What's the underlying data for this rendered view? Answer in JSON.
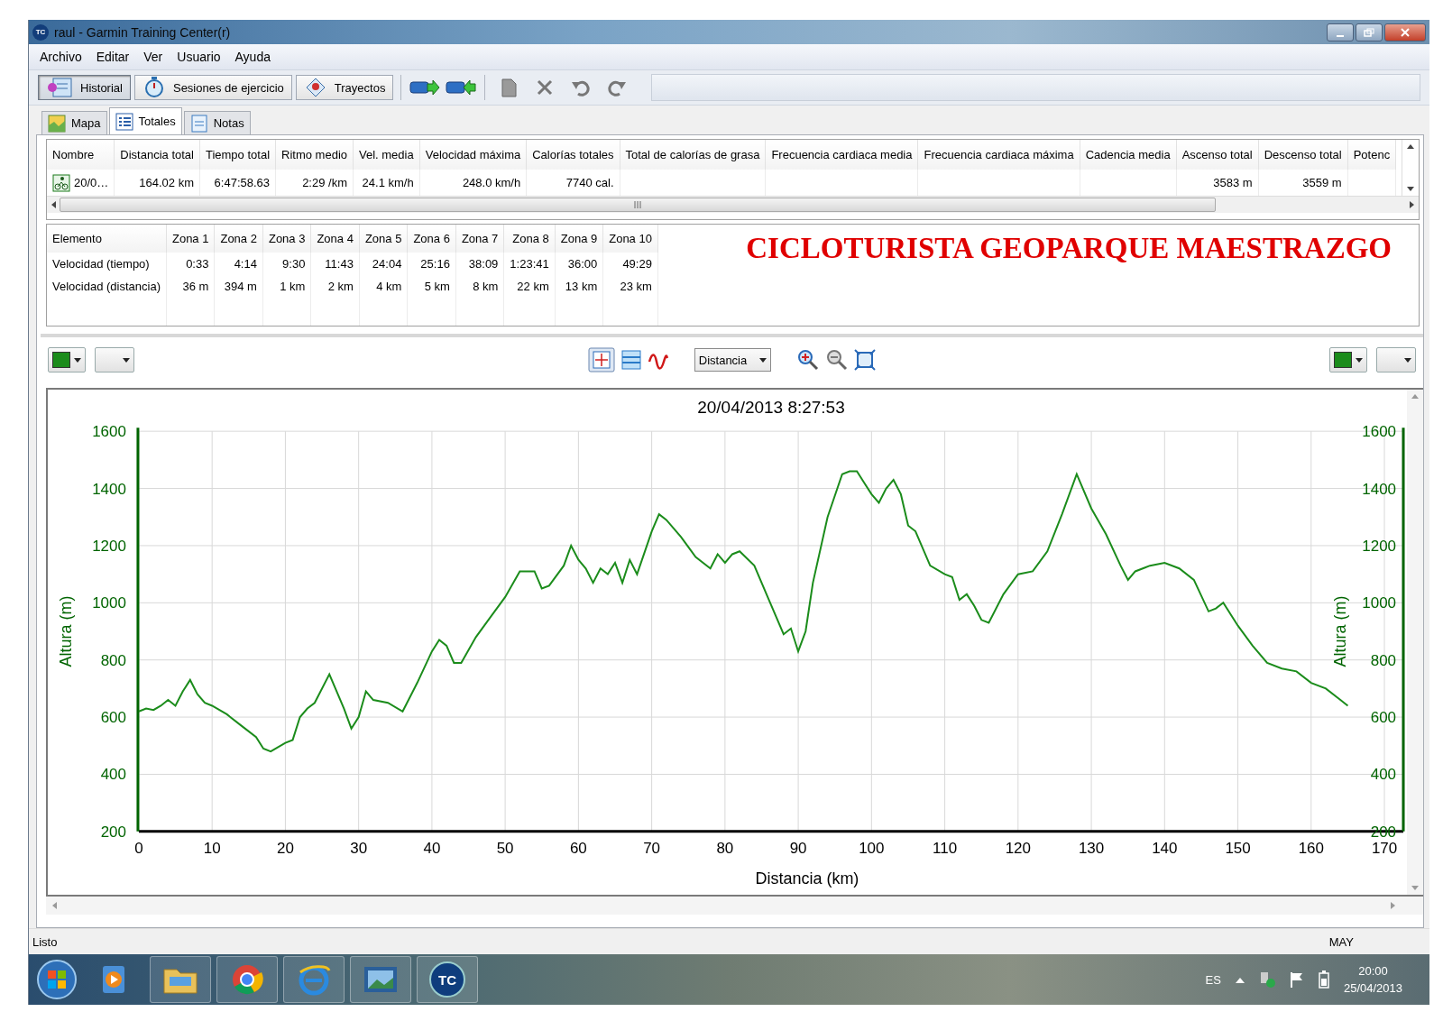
{
  "window": {
    "app_icon_text": "TC",
    "title": "raul - Garmin Training Center(r)"
  },
  "menu": [
    "Archivo",
    "Editar",
    "Ver",
    "Usuario",
    "Ayuda"
  ],
  "toolbar": {
    "views": [
      {
        "label": "Historial",
        "selected": true
      },
      {
        "label": "Sesiones de ejercicio",
        "selected": false
      },
      {
        "label": "Trayectos",
        "selected": false
      }
    ]
  },
  "subtabs": [
    {
      "label": "Mapa",
      "selected": false
    },
    {
      "label": "Totales",
      "selected": true
    },
    {
      "label": "Notas",
      "selected": false
    }
  ],
  "totals_table": {
    "columns": [
      "Nombre",
      "Distancia total",
      "Tiempo total",
      "Ritmo medio",
      "Vel. media",
      "Velocidad máxima",
      "Calorías totales",
      "Total de calorías de grasa",
      "Frecuencia cardiaca media",
      "Frecuencia cardiaca máxima",
      "Cadencia media",
      "Ascenso total",
      "Descenso total",
      "Potenc"
    ],
    "rows": [
      {
        "cells": [
          "20/0…",
          "164.02 km",
          "6:47:58.63",
          "2:29 /km",
          "24.1 km/h",
          "248.0 km/h",
          "7740 cal.",
          null,
          null,
          null,
          null,
          "3583 m",
          "3559 m",
          null
        ]
      }
    ]
  },
  "zones_table": {
    "columns": [
      "Elemento",
      "Zona 1",
      "Zona 2",
      "Zona 3",
      "Zona 4",
      "Zona 5",
      "Zona 6",
      "Zona 7",
      "Zona 8",
      "Zona 9",
      "Zona 10"
    ],
    "rows": [
      [
        "Velocidad (tiempo)",
        "0:33",
        "4:14",
        "9:30",
        "11:43",
        "24:04",
        "25:16",
        "38:09",
        "1:23:41",
        "36:00",
        "49:29"
      ],
      [
        "Velocidad (distancia)",
        "36 m",
        "394 m",
        "1 km",
        "2 km",
        "4 km",
        "5 km",
        "8 km",
        "22 km",
        "13 km",
        "23 km"
      ]
    ]
  },
  "banner": "CICLOTURISTA GEOPARQUE MAESTRAZGO",
  "chart_toolbar": {
    "axis_select": "Distancia"
  },
  "chart": {
    "chart_data": {
      "type": "line",
      "title": "20/04/2013 8:27:53",
      "xlabel": "Distancia (km)",
      "ylabel": "Altura (m)",
      "grid": true,
      "xlim": [
        0,
        170
      ],
      "ylim": [
        200,
        1600
      ],
      "xticks": [
        0,
        10,
        20,
        30,
        40,
        50,
        60,
        70,
        80,
        90,
        100,
        110,
        120,
        130,
        140,
        150,
        160,
        170
      ],
      "yticks": [
        {
          "value": 1600,
          "label": "1600"
        },
        {
          "value": 1400,
          "label": "1400"
        },
        {
          "value": 1200,
          "label": "1200"
        },
        {
          "value": 1000,
          "label": "1000"
        },
        {
          "value": 800,
          "label": "800"
        },
        {
          "value": 600,
          "label": "600"
        },
        {
          "value": 400,
          "label": "400"
        },
        {
          "value": 200,
          "label": "200"
        }
      ],
      "x": [
        0,
        1,
        2,
        3,
        4,
        5,
        6,
        7,
        8,
        9,
        10,
        12,
        14,
        16,
        17,
        18,
        20,
        21,
        22,
        23,
        24,
        26,
        28,
        29,
        30,
        31,
        32,
        34,
        36,
        38,
        40,
        41,
        42,
        43,
        44,
        46,
        48,
        50,
        52,
        54,
        55,
        56,
        58,
        59,
        60,
        61,
        62,
        63,
        64,
        65,
        66,
        67,
        68,
        70,
        71,
        72,
        74,
        76,
        78,
        79,
        80,
        81,
        82,
        84,
        86,
        88,
        89,
        90,
        91,
        92,
        94,
        96,
        97,
        98,
        99,
        100,
        101,
        102,
        103,
        104,
        105,
        106,
        108,
        110,
        111,
        112,
        113,
        114,
        115,
        116,
        118,
        120,
        122,
        124,
        126,
        128,
        130,
        132,
        134,
        135,
        136,
        138,
        140,
        142,
        144,
        146,
        147,
        148,
        150,
        152,
        154,
        156,
        158,
        160,
        162,
        164,
        165
      ],
      "series": [
        {
          "color": "#1b8c1b",
          "values": [
            620,
            630,
            625,
            640,
            660,
            640,
            690,
            730,
            680,
            650,
            640,
            610,
            570,
            530,
            490,
            480,
            510,
            520,
            600,
            630,
            650,
            750,
            630,
            560,
            600,
            690,
            660,
            650,
            620,
            720,
            830,
            870,
            850,
            790,
            790,
            880,
            950,
            1020,
            1110,
            1110,
            1050,
            1060,
            1130,
            1200,
            1150,
            1120,
            1070,
            1120,
            1100,
            1140,
            1070,
            1150,
            1100,
            1250,
            1310,
            1290,
            1230,
            1160,
            1120,
            1170,
            1140,
            1170,
            1180,
            1130,
            1010,
            890,
            910,
            830,
            900,
            1070,
            1300,
            1450,
            1460,
            1460,
            1420,
            1380,
            1350,
            1400,
            1430,
            1380,
            1270,
            1250,
            1130,
            1100,
            1090,
            1010,
            1030,
            990,
            940,
            930,
            1030,
            1100,
            1110,
            1180,
            1310,
            1450,
            1330,
            1240,
            1130,
            1080,
            1110,
            1130,
            1140,
            1120,
            1080,
            970,
            980,
            1000,
            920,
            850,
            790,
            770,
            760,
            720,
            700,
            660,
            640
          ]
        }
      ]
    },
    "right_axis": {
      "label": "Altura (m)",
      "ticks": [
        "1600",
        "1400",
        "1200",
        "1000",
        "800",
        "600",
        "400",
        "200"
      ]
    }
  },
  "status_bar": {
    "text": "Listo",
    "caps": "MAY"
  },
  "taskbar": {
    "app_text": "TC",
    "language": "ES",
    "time": "20:00",
    "date": "25/04/2013"
  }
}
